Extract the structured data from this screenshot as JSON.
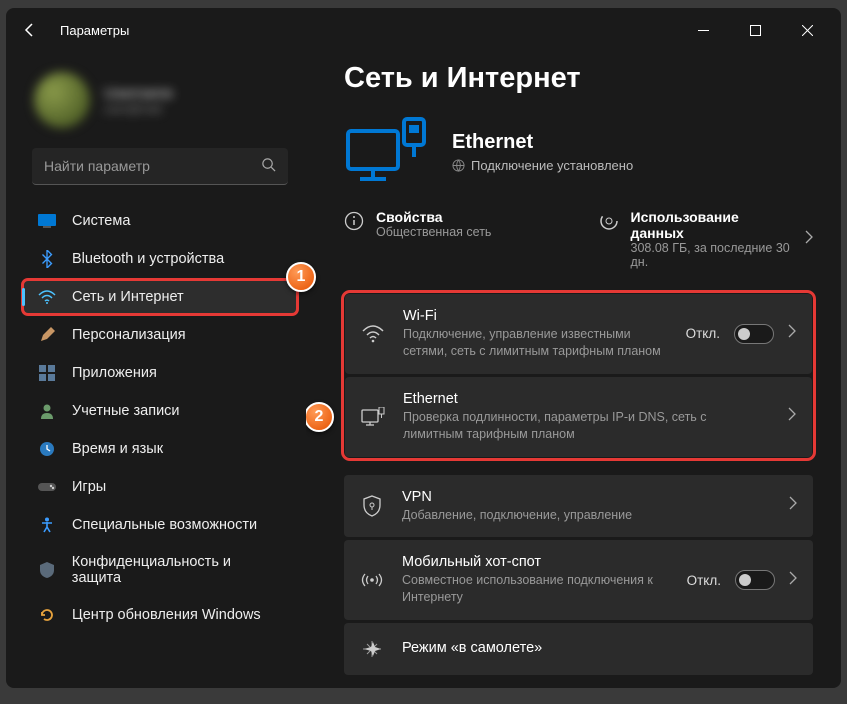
{
  "window": {
    "title": "Параметры"
  },
  "user": {
    "name": "Username",
    "email": "user@mail"
  },
  "search": {
    "placeholder": "Найти параметр"
  },
  "sidebar": {
    "items": [
      {
        "label": "Система",
        "icon": "system"
      },
      {
        "label": "Bluetooth и устройства",
        "icon": "bluetooth"
      },
      {
        "label": "Сеть и Интернет",
        "icon": "network",
        "active": true,
        "highlight": true
      },
      {
        "label": "Персонализация",
        "icon": "personalize"
      },
      {
        "label": "Приложения",
        "icon": "apps"
      },
      {
        "label": "Учетные записи",
        "icon": "accounts"
      },
      {
        "label": "Время и язык",
        "icon": "time"
      },
      {
        "label": "Игры",
        "icon": "games"
      },
      {
        "label": "Специальные возможности",
        "icon": "accessibility"
      },
      {
        "label": "Конфиденциальность и защита",
        "icon": "privacy"
      },
      {
        "label": "Центр обновления Windows",
        "icon": "update"
      }
    ]
  },
  "page": {
    "title": "Сеть и Интернет",
    "status": {
      "name": "Ethernet",
      "sub": "Подключение установлено"
    },
    "info": {
      "props": {
        "title": "Свойства",
        "sub": "Общественная сеть"
      },
      "usage": {
        "title": "Использование данных",
        "sub": "308.08 ГБ, за последние 30 дн."
      }
    },
    "cards": [
      {
        "title": "Wi-Fi",
        "sub": "Подключение, управление известными сетями, сеть с лимитным тарифным планом",
        "toggle": "Откл.",
        "icon": "wifi"
      },
      {
        "title": "Ethernet",
        "sub": "Проверка подлинности, параметры IP-и DNS, сеть с лимитным тарифным планом",
        "icon": "ethernet",
        "highlight": true
      },
      {
        "title": "VPN",
        "sub": "Добавление, подключение, управление",
        "icon": "vpn"
      },
      {
        "title": "Мобильный хот-спот",
        "sub": "Совместное использование подключения к Интернету",
        "toggle": "Откл.",
        "icon": "hotspot"
      },
      {
        "title": "Режим «в самолете»",
        "sub": "",
        "icon": "airplane"
      }
    ]
  },
  "badges": {
    "one": "1",
    "two": "2"
  }
}
